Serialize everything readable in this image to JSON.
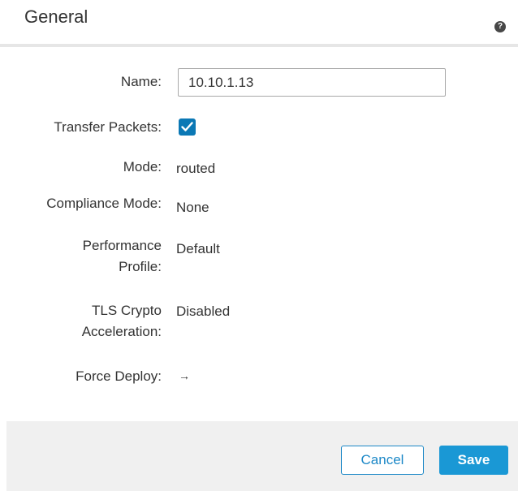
{
  "dialog": {
    "title": "General",
    "help_icon": "question-circle-icon",
    "help_glyph": "?"
  },
  "form": {
    "name_label": "Name:",
    "name_value": "10.10.1.13",
    "transfer_packets_label": "Transfer Packets:",
    "transfer_packets_checked": true,
    "mode_label": "Mode:",
    "mode_value": "routed",
    "compliance_mode_label": "Compliance Mode:",
    "compliance_mode_value": "None",
    "performance_profile_label_line1": "Performance",
    "performance_profile_label_line2": "Profile:",
    "performance_profile_value": "Default",
    "tls_crypto_label_line1": "TLS Crypto",
    "tls_crypto_label_line2": "Acceleration:",
    "tls_crypto_value": "Disabled",
    "force_deploy_label": "Force Deploy:",
    "force_deploy_glyph": "→",
    "force_deploy_icon": "arrow-right-icon"
  },
  "footer": {
    "cancel_label": "Cancel",
    "save_label": "Save"
  },
  "colors": {
    "accent": "#1a98d5",
    "checkbox": "#0b78b5",
    "footer_bg": "#f0f0f0"
  }
}
